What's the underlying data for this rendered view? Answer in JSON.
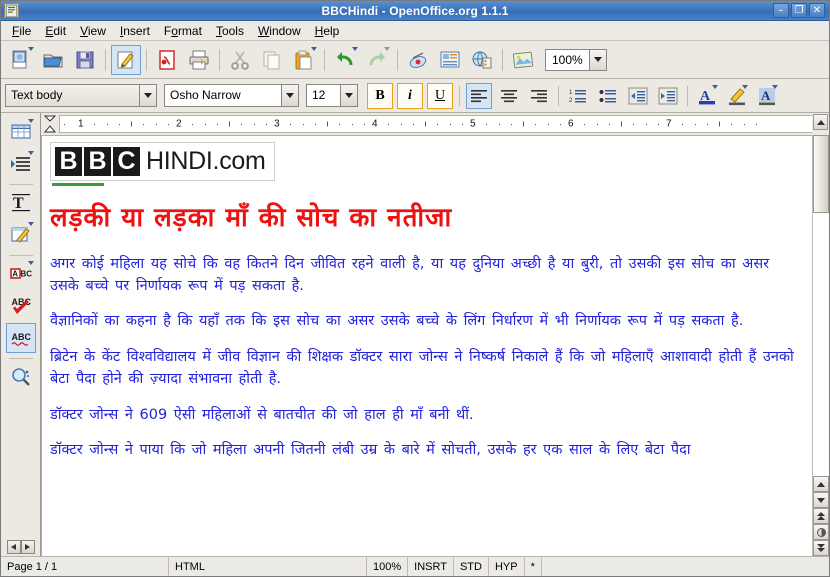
{
  "window": {
    "title": "BBCHindi - OpenOffice.org 1.1.1",
    "app_icon": "writer-document-icon",
    "minimize_label": "–",
    "restore_label": "❐",
    "close_label": "✕"
  },
  "menubar": {
    "items": [
      {
        "label": "File",
        "accel": "F"
      },
      {
        "label": "Edit",
        "accel": "E"
      },
      {
        "label": "View",
        "accel": "V"
      },
      {
        "label": "Insert",
        "accel": "I"
      },
      {
        "label": "Format",
        "accel": "o"
      },
      {
        "label": "Tools",
        "accel": "T"
      },
      {
        "label": "Window",
        "accel": "W"
      },
      {
        "label": "Help",
        "accel": "H"
      }
    ]
  },
  "toolbar": {
    "buttons": [
      {
        "name": "new-document",
        "label": "New"
      },
      {
        "name": "open-document",
        "label": "Open"
      },
      {
        "name": "save-document",
        "label": "Save"
      },
      {
        "name": "edit-file",
        "label": "Edit File"
      },
      {
        "name": "export-pdf",
        "label": "Export Directly as PDF"
      },
      {
        "name": "print-file",
        "label": "Print File Directly"
      },
      {
        "name": "cut",
        "label": "Cut"
      },
      {
        "name": "copy",
        "label": "Copy"
      },
      {
        "name": "paste",
        "label": "Paste"
      },
      {
        "name": "undo",
        "label": "Undo"
      },
      {
        "name": "redo",
        "label": "Redo"
      },
      {
        "name": "navigator",
        "label": "Navigator"
      },
      {
        "name": "gallery",
        "label": "Gallery"
      },
      {
        "name": "data-sources",
        "label": "Data Sources"
      },
      {
        "name": "online-layout",
        "label": "Online Layout"
      }
    ],
    "zoom_value": "100%"
  },
  "formatbar": {
    "paragraph_style": "Text body",
    "font_name": "Osho Narrow",
    "font_size": "12",
    "bold_label": "B",
    "italic_label": "i",
    "underline_label": "U",
    "buttons": [
      {
        "name": "align-left",
        "label": "Align Left"
      },
      {
        "name": "align-center",
        "label": "Centered"
      },
      {
        "name": "align-right",
        "label": "Align Right"
      },
      {
        "name": "numbering-on-off",
        "label": "Numbering On/Off"
      },
      {
        "name": "bullets-on-off",
        "label": "Bullets On/Off"
      },
      {
        "name": "decrease-indent",
        "label": "Decrease Indent"
      },
      {
        "name": "increase-indent",
        "label": "Increase Indent"
      },
      {
        "name": "font-color",
        "label": "Font Color"
      },
      {
        "name": "highlighting",
        "label": "Highlighting"
      },
      {
        "name": "background-color",
        "label": "Background Color"
      }
    ]
  },
  "toolpalette": {
    "items": [
      {
        "name": "insert-table",
        "label": "Insert Table"
      },
      {
        "name": "insert-fields",
        "label": "Insert Fields"
      },
      {
        "name": "insert-text-frame",
        "label": "Insert Text Frame"
      },
      {
        "name": "insert-draw-functions",
        "label": "Show Draw Functions"
      },
      {
        "name": "find-replace",
        "label": "Find & Replace"
      },
      {
        "name": "spellcheck",
        "label": "Spellcheck"
      },
      {
        "name": "autospellcheck",
        "label": "AutoSpellcheck On/Off"
      },
      {
        "name": "graphics-view",
        "label": "Graphics On/Off"
      }
    ]
  },
  "ruler": {
    "ticks": [
      "1",
      "2",
      "3",
      "4",
      "5",
      "6",
      "7"
    ],
    "unit": "inch"
  },
  "document": {
    "logo": {
      "squares": [
        "B",
        "B",
        "C"
      ],
      "word": "HINDI.com"
    },
    "headline": "लड़की या लड़का माँ की सोच का नतीजा",
    "paragraphs": [
      "अगर कोई महिला यह सोचे कि वह कितने दिन जीवित रहने वाली है, या यह दुनिया अच्छी है या बुरी, तो उसकी इस सोच का असर उसके बच्चे पर निर्णायक रूप में पड़ सकता है.",
      "वैज्ञानिकों का कहना है कि यहाँ तक कि इस सोच का असर उसके बच्चे के लिंग निर्धारण में भी निर्णायक रूप में पड़ सकता है.",
      "ब्रिटेन के केंट विश्वविद्यालय में जीव विज्ञान की शिक्षक डॉक्टर सारा जोन्स ने निष्कर्ष निकाले हैं कि जो महिलाएँ आशावादी होती हैं उनको बेटा पैदा होने की ज़्यादा संभावना होती है.",
      "डॉक्टर जोन्स ने 609 ऐसी महिलाओं से बातचीत की जो हाल ही माँ बनी थीं.",
      "डॉक्टर जोन्स ने पाया कि जो महिला अपनी जितनी लंबी उम्र के बारे में सोचती, उसके हर एक साल के लिए बेटा पैदा"
    ],
    "colors": {
      "headline": "#ee1111",
      "body": "#2222dd",
      "logo_box": "#1a1a1a",
      "accent_green": "#3d9a3d"
    }
  },
  "statusbar": {
    "page": "Page 1 / 1",
    "doc_type": "HTML",
    "zoom": "100%",
    "insert_mode": "INSRT",
    "selection_mode": "STD",
    "hyperlink_mode": "HYP",
    "modified": "*"
  }
}
